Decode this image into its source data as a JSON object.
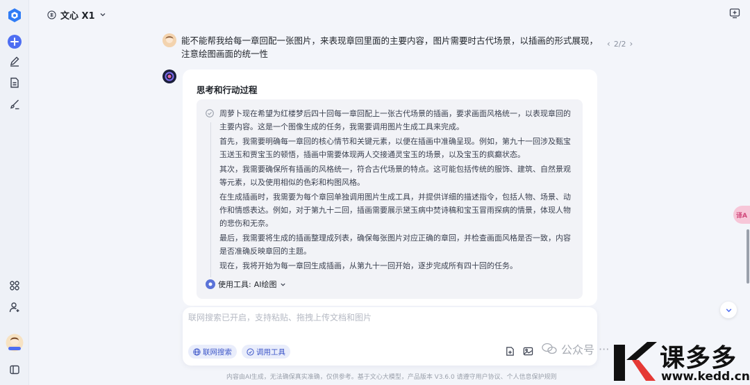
{
  "header": {
    "model_name": "文心 X1"
  },
  "conversation": {
    "user_message": "能不能帮我给每一章回配一张图片，来表现章回里面的主要内容，图片需要时古代场景，以插画的形式展现，注意绘图画面的统一性",
    "pager": "2/2",
    "bot": {
      "section_title": "思考和行动过程",
      "thinking_paragraphs": [
        "周萝卜现在希望为红楼梦后四十回每一章回配上一张古代场景的插画，要求画面风格统一，以表现章回的主要内容。这是一个图像生成的任务，我需要调用图片生成工具来完成。",
        "首先，我需要明确每一章回的核心情节和关键元素，以便在插画中准确呈现。例如，第九十一回涉及甄宝玉送玉和贾宝玉的顿悟，插画中需要体现两人交接通灵宝玉的场景，以及宝玉的疯癫状态。",
        "其次，我需要确保所有插画的风格统一，符合古代场景的特点。这可能包括传统的服饰、建筑、自然景观等元素，以及使用相似的色彩和构图风格。",
        "在生成插画时，我需要为每个章回单独调用图片生成工具，并提供详细的描述指令，包括人物、场景、动作和情感表达。例如，对于第九十二回，插画需要展示黛玉病中焚诗稿和宝玉冒雨探病的情景，体现人物的悲伤和无奈。",
        "最后，我需要将生成的插画整理成列表，确保每张图片对应正确的章回，并检查画面风格是否一致，内容是否准确反映章回的主题。",
        "现在，我将开始为每一章回生成插画，从第九十一回开始，逐步完成所有四十回的任务。"
      ],
      "tool_label": "使用工具:",
      "tool_name": "AI绘图"
    }
  },
  "input": {
    "placeholder": "联网搜索已开启，支持粘贴、拖拽上传文档和图片",
    "web_search_label": "联网搜索",
    "call_tool_label": "调用工具"
  },
  "side": {
    "translate_label": "译A"
  },
  "watermark": {
    "wechat_text": "公众号",
    "brand_big": "课多多",
    "brand_url": "www.kedd.cn"
  },
  "footer": {
    "disclaimer": "内容由AI生成，无法确保真实准确，仅供参考。基于文心大模型，产品版本 V3.6.0 请遵守用户协议、个人信息保护规则"
  },
  "colors": {
    "accent": "#4e6ef2",
    "sidebar_bg": "#eef1f7",
    "page_bg": "#f3f5fa",
    "thinking_bg": "#f2f3f7"
  }
}
